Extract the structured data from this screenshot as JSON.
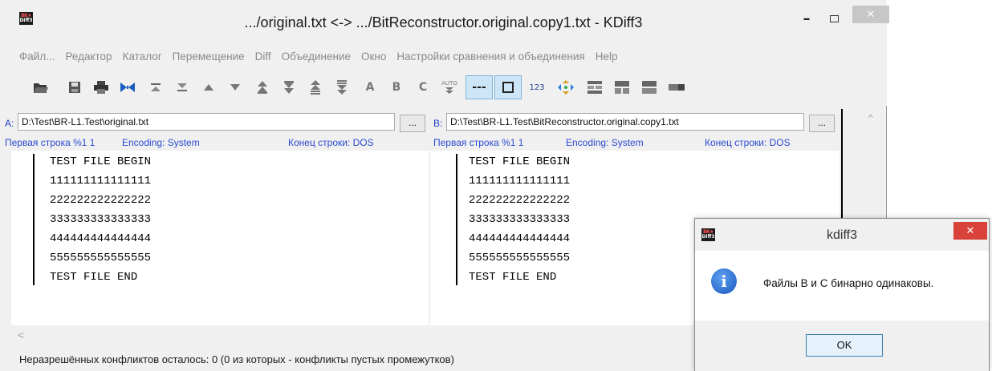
{
  "window": {
    "title": ".../original.txt <-> .../BitReconstructor.original.copy1.txt - KDiff3",
    "logo_top": "BK★",
    "logo_bottom": "Diff3",
    "minimize_glyph": "–",
    "close_glyph": "✕"
  },
  "menu": [
    "Файл...",
    "Редактор",
    "Каталог",
    "Перемещение",
    "Diff",
    "Объединение",
    "Окно",
    "Настройки сравнения и объединения",
    "Help"
  ],
  "toolbar": {
    "icons": [
      "open-folder-icon",
      "save-icon",
      "print-icon",
      "bowtie-icon",
      "go-top-icon",
      "go-bottom-icon",
      "prev-delta-icon",
      "next-delta-icon",
      "prev-conflict-icon",
      "next-conflict-icon",
      "prev-unsolved-icon",
      "next-unsolved-icon",
      "select-a-icon",
      "select-b-icon",
      "select-c-icon",
      "auto-advance-icon",
      "show-whitespace-icon",
      "show-linenumbers-icon",
      "line-numbers-icon",
      "merge-icon",
      "split-icon-1",
      "split-icon-2",
      "split-icon-3",
      "split-icon-4"
    ],
    "label_a": "A",
    "label_b": "B",
    "label_c": "C",
    "label_auto": "AUTO",
    "label_dashes": "---",
    "label_123": "123"
  },
  "panel_a": {
    "label": "A:",
    "path": "D:\\Test\\BR-L1.Test\\original.txt",
    "browse": "...",
    "first_line": "Первая строка %1 1",
    "encoding": "Encoding: System",
    "line_end": "Конец строки: DOS",
    "lines": [
      "TEST FILE BEGIN",
      "111111111111111",
      "222222222222222",
      "333333333333333",
      "444444444444444",
      "555555555555555",
      "TEST FILE END"
    ]
  },
  "panel_b": {
    "label": "B:",
    "path": "D:\\Test\\BR-L1.Test\\BitReconstructor.original.copy1.txt",
    "browse": "...",
    "first_line": "Первая строка %1 1",
    "encoding": "Encoding: System",
    "line_end": "Конец строки: DOS",
    "lines": [
      "TEST FILE BEGIN",
      "111111111111111",
      "222222222222222",
      "333333333333333",
      "444444444444444",
      "555555555555555",
      "TEST FILE END"
    ]
  },
  "status": "Неразрешённых конфликтов осталось: 0 (0 из которых - конфликты пустых промежутков)",
  "dialog": {
    "title": "kdiff3",
    "message": "Файлы B и C бинарно одинаковы.",
    "ok": "OK",
    "icon": "info-icon"
  }
}
